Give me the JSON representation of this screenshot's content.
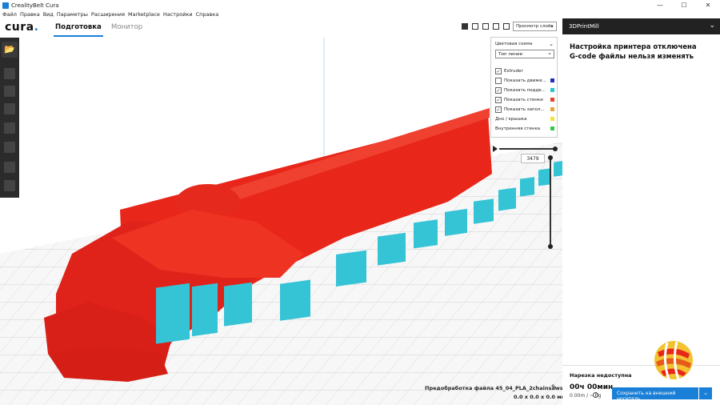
{
  "window": {
    "title": "CrealityBelt Cura",
    "minimize": "—",
    "maximize": "☐",
    "close": "✕"
  },
  "menu": [
    "Файл",
    "Правка",
    "Вид",
    "Параметры",
    "Расширения",
    "Marketplace",
    "Настройки",
    "Справка"
  ],
  "header": {
    "logo": "cura",
    "logo_dot": ".",
    "tab_prepare": "Подготовка",
    "tab_monitor": "Монитор",
    "view_select": "Просмотр слоёв"
  },
  "scheme_panel": {
    "title": "Цветовая схема",
    "dropdown": "Тип линии",
    "rows": [
      {
        "label": "Extruder",
        "checked": true,
        "color": ""
      },
      {
        "label": "Показать движе...",
        "checked": false,
        "color": "#1f2fb8"
      },
      {
        "label": "Показать подде...",
        "checked": true,
        "color": "#29c3d6"
      },
      {
        "label": "Показать стенки",
        "checked": true,
        "color": "#e8402a"
      },
      {
        "label": "Показать запол...",
        "checked": true,
        "color": "#e8a43a"
      },
      {
        "label": "Дно / крышка",
        "checked": null,
        "color": "#f2e23a"
      },
      {
        "label": "Внутренняя стенка",
        "checked": null,
        "color": "#39c94a"
      }
    ]
  },
  "layer": {
    "value": "3479"
  },
  "right_panel": {
    "printer": "3DPrintMill",
    "message_line1": "Настройка принтера отключена",
    "message_line2": "G-code файлы нельзя изменять",
    "slice_status": "Нарезка недоступна",
    "time": "00ч 00мин",
    "filament": "0.00m / ~ 0g",
    "save_button": "Сохранить на внешний носитель",
    "info": "i"
  },
  "preview": {
    "file": "Предобработка файла 45_04_PLA_2chainsawsword",
    "dims": "0.0 x 0.0 x 0.0 мм"
  },
  "colors": {
    "accent": "#1a7fd6",
    "walls": "#e8261a",
    "support": "#35c3d6"
  }
}
